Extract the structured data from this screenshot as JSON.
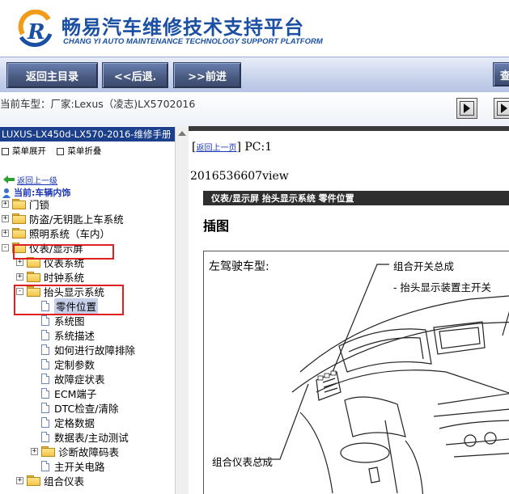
{
  "header": {
    "title": "畅易汽车维修技术支持平台",
    "subtitle": "CHANG YI AUTO MAINTENANCE TECHNOLOGY SUPPORT PLATFORM",
    "brand_color": "#1a4fa3"
  },
  "toolbar": {
    "home_label": "返回主目录",
    "back_label": "<<后退.",
    "forward_label": ">>前进",
    "query_label": "查"
  },
  "model": {
    "text": "当前车型：厂家:Lexus（凌志)LX5702016"
  },
  "sidebar": {
    "title": "LUXUS-LX450d-LX570-2016-维修手册",
    "expand_label": "菜单展开",
    "collapse_label": "菜单折叠",
    "back_link": "返回上一级",
    "current_label": "当前:车辆内饰",
    "items": [
      {
        "label": "门锁",
        "type": "folder",
        "level": 0,
        "toggle": "+"
      },
      {
        "label": "防盗/无钥匙上车系统",
        "type": "folder",
        "level": 0,
        "toggle": "+"
      },
      {
        "label": "照明系统（车内）",
        "type": "folder",
        "level": 0,
        "toggle": "+"
      },
      {
        "label": "仪表/显示屏",
        "type": "folder",
        "level": 0,
        "toggle": "-"
      },
      {
        "label": "仪表系统",
        "type": "folder",
        "level": 1,
        "toggle": "+"
      },
      {
        "label": "时钟系统",
        "type": "folder",
        "level": 1,
        "toggle": "+"
      },
      {
        "label": "抬头显示系统",
        "type": "folder",
        "level": 1,
        "toggle": "-"
      },
      {
        "label": "零件位置",
        "type": "doc",
        "level": 2,
        "selected": true
      },
      {
        "label": "系统图",
        "type": "doc",
        "level": 2
      },
      {
        "label": "系统描述",
        "type": "doc",
        "level": 2
      },
      {
        "label": "如何进行故障排除",
        "type": "doc",
        "level": 2
      },
      {
        "label": "定制参数",
        "type": "doc",
        "level": 2
      },
      {
        "label": "故障症状表",
        "type": "doc",
        "level": 2
      },
      {
        "label": "ECM端子",
        "type": "doc",
        "level": 2
      },
      {
        "label": "DTC检查/清除",
        "type": "doc",
        "level": 2
      },
      {
        "label": "定格数据",
        "type": "doc",
        "level": 2
      },
      {
        "label": "数据表/主动测试",
        "type": "doc",
        "level": 2
      },
      {
        "label": "诊断故障码表",
        "type": "folder",
        "level": 2,
        "toggle": "+"
      },
      {
        "label": "主开关电路",
        "type": "doc",
        "level": 2
      },
      {
        "label": "组合仪表",
        "type": "folder",
        "level": 1,
        "toggle": "+"
      }
    ]
  },
  "content": {
    "prev_link": "返回上一页",
    "pc_label": "PC:1",
    "view_id": "2016536607view",
    "section_title": "仪表/显示屏  抬头显示系统  零件位置",
    "illustration_title": "插图",
    "figure": {
      "lhd_label": "左驾驶车型:",
      "callout_1": "组合开关总成",
      "callout_2": "- 抬头显示装置主开关",
      "callout_3": "组合仪表总成"
    }
  },
  "colors": {
    "toolbar_button": "#48597f",
    "sidebar_title_bg": "#1c3f8c",
    "highlight_box": "#e02020",
    "link": "#1a35b8"
  }
}
